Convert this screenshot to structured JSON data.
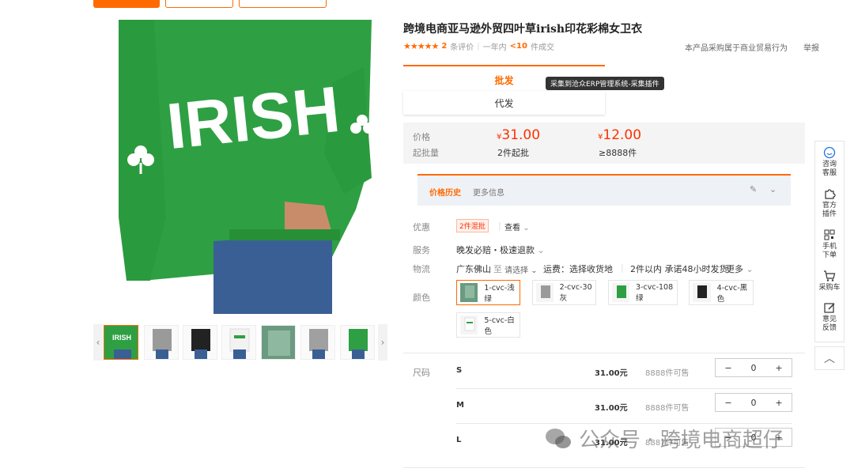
{
  "product": {
    "title": "跨境电商亚马逊外贸四叶草irish印花彩棉女卫衣",
    "main_image_text": "IRISH",
    "review_count": "2",
    "review_label": "条评价",
    "sales_prefix": "一年内",
    "sales_value": "<10",
    "sales_suffix": "件成交",
    "stars": "★★★★★"
  },
  "links": {
    "business": "本产品采购属于商业贸易行为",
    "report": "举报"
  },
  "tabs": {
    "wholesale": "批发",
    "dropship": "代发"
  },
  "tooltip": "采集到沧众ERP管理系统-采集插件",
  "price": {
    "label_price": "价格",
    "label_moq": "起批量",
    "tier1_value": "31.00",
    "tier1_moq": "2件起批",
    "tier2_value": "12.00",
    "tier2_moq": "≥8888件",
    "currency": "¥"
  },
  "history": {
    "tab_history": "价格历史",
    "tab_more": "更多信息"
  },
  "offer": {
    "label": "优惠",
    "badge": "2件混批",
    "view": "查看"
  },
  "service": {
    "label": "服务",
    "value": "晚发必赔・极速退款"
  },
  "logistics": {
    "label": "物流",
    "from": "广东佛山",
    "to_word": "至",
    "select": "请选择",
    "freight": "运费：选择收货地",
    "promise": "2件以内 承诺48小时发货",
    "more": "更多"
  },
  "colors": {
    "label": "颜色",
    "options": [
      "1-cvc-浅绿",
      "2-cvc-30灰",
      "3-cvc-108绿",
      "4-cvc-黑色",
      "5-cvc-白色"
    ]
  },
  "sizes": {
    "label": "尺码",
    "rows": [
      {
        "name": "S",
        "price": "31.00元",
        "stock": "8888件可售",
        "qty": "0"
      },
      {
        "name": "M",
        "price": "31.00元",
        "stock": "8888件可售",
        "qty": "0"
      },
      {
        "name": "L",
        "price": "31.00元",
        "stock": "8887件可售",
        "qty": "0"
      }
    ],
    "minus": "−",
    "plus": "+"
  },
  "float_bar": {
    "consult": "咨询客服",
    "plugin": "官方插件",
    "mobile": "手机下单",
    "cart": "采购车",
    "feedback": "意见反馈"
  },
  "watermark": "公众号 · 跨境电商超仔",
  "colors_theme": {
    "accent": "#ff6a00",
    "price": "#ff3000",
    "sweater": "#2ea043"
  }
}
